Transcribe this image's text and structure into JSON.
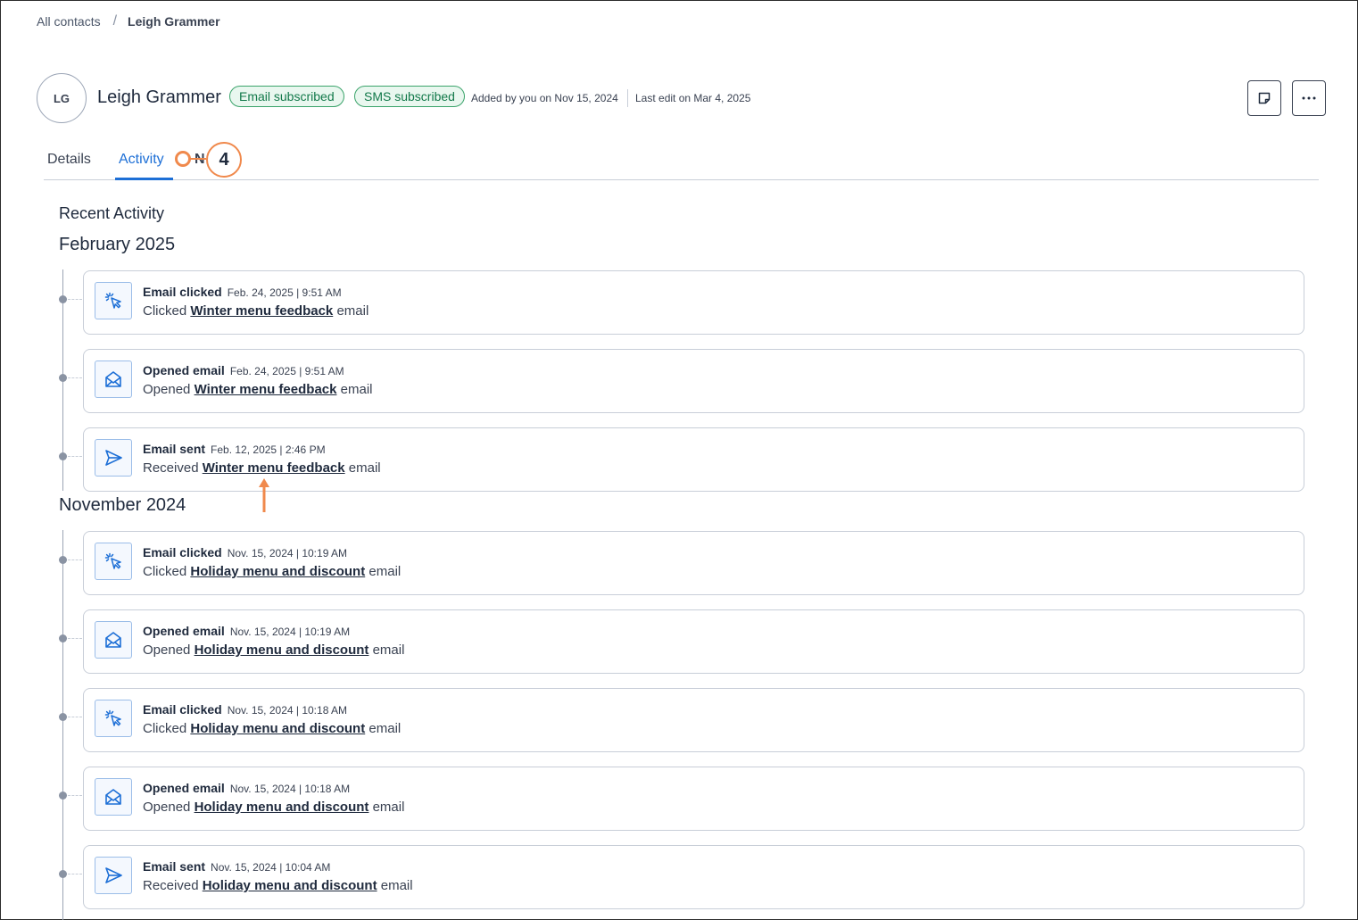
{
  "breadcrumb": {
    "parent": "All contacts",
    "separator": "/",
    "current": "Leigh Grammer"
  },
  "contact": {
    "initials": "LG",
    "name": "Leigh Grammer",
    "badges": {
      "email": "Email subscribed",
      "sms": "SMS subscribed"
    },
    "added": "Added by you on Nov 15, 2024",
    "last_edit": "Last edit on Mar 4, 2025"
  },
  "actions": {
    "note_icon": "sticky-note-icon",
    "more_icon": "more-horizontal-icon"
  },
  "tabs": {
    "details": "Details",
    "activity": "Activity",
    "notes_partial": "N"
  },
  "callout": {
    "number": "4",
    "color": "#f0894c"
  },
  "section_title": "Recent Activity",
  "months": [
    {
      "label": "February 2025",
      "items": [
        {
          "type": "click",
          "icon": "cursor-click-icon",
          "title": "Email clicked",
          "date": "Feb. 24, 2025 | 9:51 AM",
          "prefix": "Clicked",
          "link": "Winter menu feedback",
          "suffix": "email"
        },
        {
          "type": "open",
          "icon": "envelope-open-icon",
          "title": "Opened email",
          "date": "Feb. 24, 2025 | 9:51 AM",
          "prefix": "Opened",
          "link": "Winter menu feedback",
          "suffix": "email"
        },
        {
          "type": "send",
          "icon": "paper-plane-icon",
          "title": "Email sent",
          "date": "Feb. 12, 2025 | 2:46 PM",
          "prefix": "Received",
          "link": "Winter menu feedback",
          "suffix": "email"
        }
      ]
    },
    {
      "label": "November 2024",
      "items": [
        {
          "type": "click",
          "icon": "cursor-click-icon",
          "title": "Email clicked",
          "date": "Nov. 15, 2024 | 10:19 AM",
          "prefix": "Clicked",
          "link": "Holiday menu and discount",
          "suffix": "email"
        },
        {
          "type": "open",
          "icon": "envelope-open-icon",
          "title": "Opened email",
          "date": "Nov. 15, 2024 | 10:19 AM",
          "prefix": "Opened",
          "link": "Holiday menu and discount",
          "suffix": "email"
        },
        {
          "type": "click",
          "icon": "cursor-click-icon",
          "title": "Email clicked",
          "date": "Nov. 15, 2024 | 10:18 AM",
          "prefix": "Clicked",
          "link": "Holiday menu and discount",
          "suffix": "email"
        },
        {
          "type": "open",
          "icon": "envelope-open-icon",
          "title": "Opened email",
          "date": "Nov. 15, 2024 | 10:18 AM",
          "prefix": "Opened",
          "link": "Holiday menu and discount",
          "suffix": "email"
        },
        {
          "type": "send",
          "icon": "paper-plane-icon",
          "title": "Email sent",
          "date": "Nov. 15, 2024 | 10:04 AM",
          "prefix": "Received",
          "link": "Holiday menu and discount",
          "suffix": "email"
        }
      ]
    }
  ]
}
